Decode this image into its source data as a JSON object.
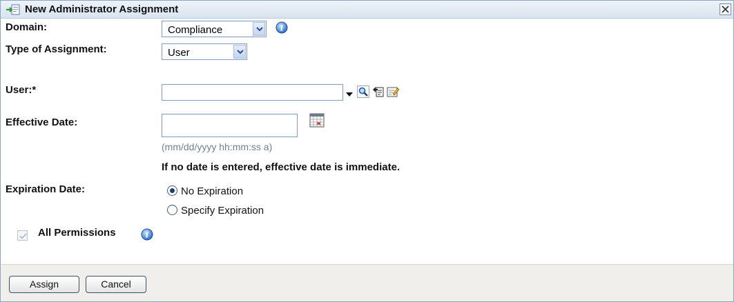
{
  "dialog": {
    "title": "New Administrator Assignment"
  },
  "form": {
    "domain_label": "Domain:",
    "domain_value": "Compliance",
    "type_label": "Type of Assignment:",
    "type_value": "User",
    "user_label": "User:*",
    "user_value": "",
    "effective_label": "Effective Date:",
    "effective_value": "",
    "effective_hint": "(mm/dd/yyyy hh:mm:ss a)",
    "effective_note": "If no date is entered, effective date is immediate.",
    "expiration_label": "Expiration Date:",
    "expiration_options": [
      "No Expiration",
      "Specify Expiration"
    ],
    "expiration_selected": "No Expiration",
    "all_permissions_label": "All Permissions",
    "all_permissions_checked": true
  },
  "buttons": {
    "assign": "Assign",
    "cancel": "Cancel"
  },
  "icons": {
    "title": "assign-admin-icon",
    "close": "close-icon",
    "info": "info-icon",
    "search": "search-icon",
    "browse": "tree-browse-icon",
    "edit": "edit-icon",
    "calendar": "calendar-icon"
  }
}
